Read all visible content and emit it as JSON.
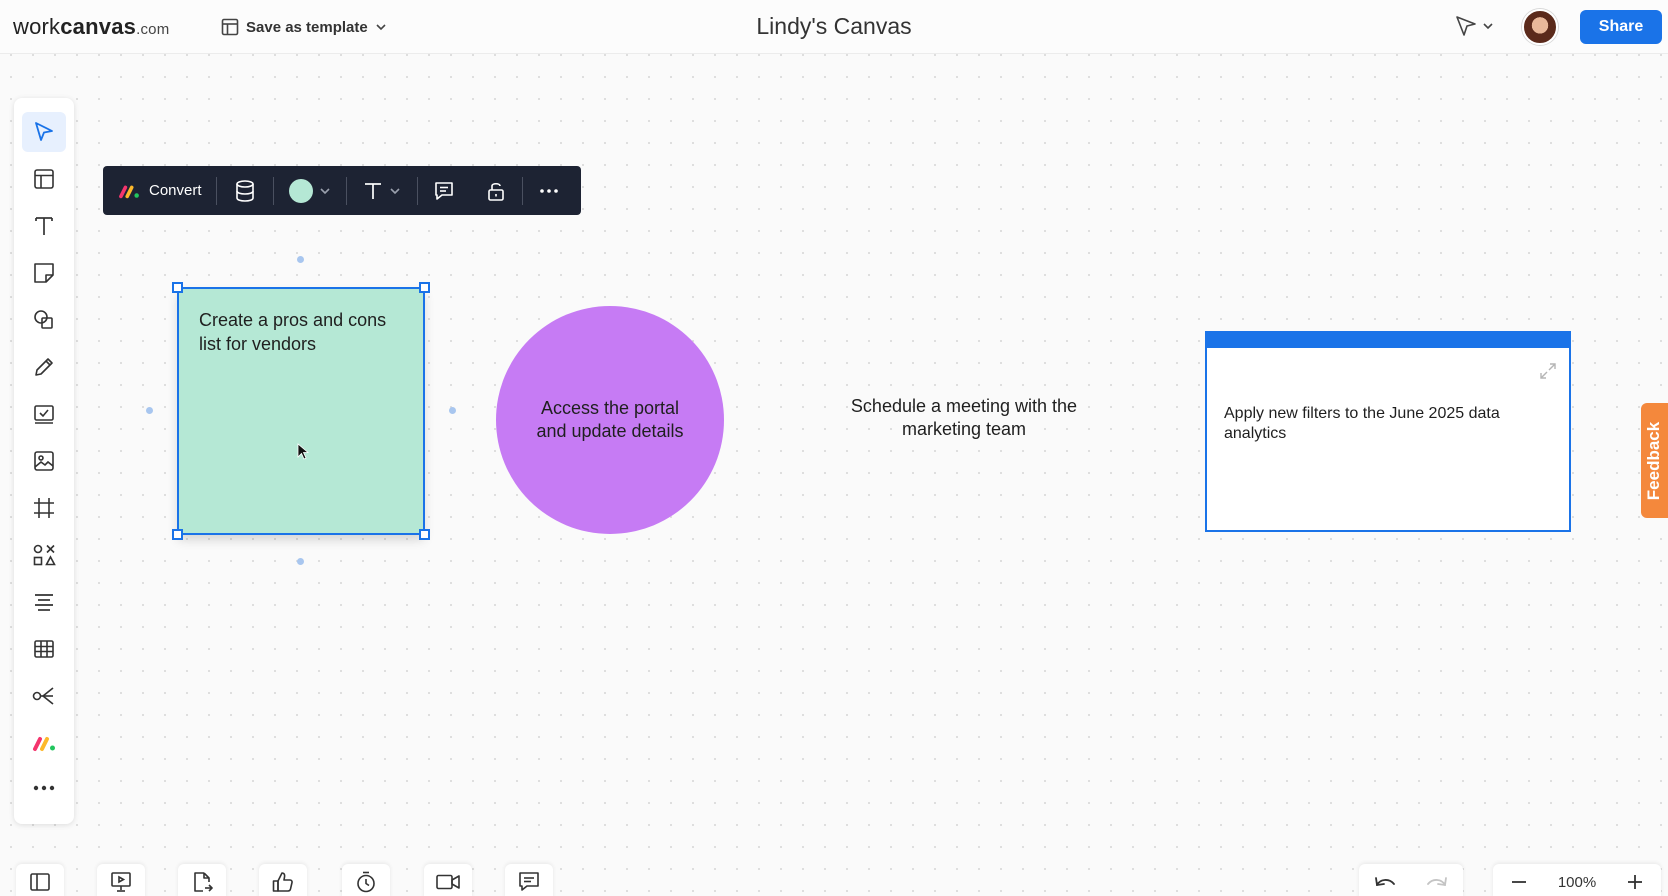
{
  "header": {
    "logo": {
      "part1": "work",
      "part2": "canvas",
      "part3": ".com"
    },
    "save_template_label": "Save as template",
    "canvas_title": "Lindy's Canvas",
    "share_label": "Share"
  },
  "float_toolbar": {
    "convert_label": "Convert",
    "fill_color": "#b5e8d5"
  },
  "canvas": {
    "sticky_note": {
      "text": "Create a pros and cons list for vendors",
      "color": "#b5e8d5"
    },
    "circle": {
      "text": "Access the portal and update details",
      "color": "#c67bf4"
    },
    "text_block": {
      "text": "Schedule a meeting with the marketing team"
    },
    "card": {
      "text": "Apply new filters to the June 2025 data analytics",
      "accent": "#1a73e8"
    }
  },
  "feedback_label": "Feedback",
  "zoom": {
    "level": "100%"
  },
  "colors": {
    "accent": "#1a73e8",
    "feedback": "#f4883c",
    "toolbar_dark": "#1d2333"
  },
  "left_toolbar_icons": [
    "select-icon",
    "template-icon",
    "text-icon",
    "sticky-note-icon",
    "shapes-icon",
    "pen-icon",
    "checkbox-icon",
    "image-icon",
    "frame-icon",
    "symbols-icon",
    "align-icon",
    "table-icon",
    "share-nodes-icon",
    "monday-icon",
    "more-icon"
  ],
  "bottom_bar_icons": [
    "panel-icon",
    "presentation-icon",
    "export-icon",
    "thumbs-up-icon",
    "timer-icon",
    "video-icon",
    "comment-icon",
    "undo-icon",
    "redo-icon",
    "zoom-out-icon",
    "zoom-in-icon"
  ]
}
